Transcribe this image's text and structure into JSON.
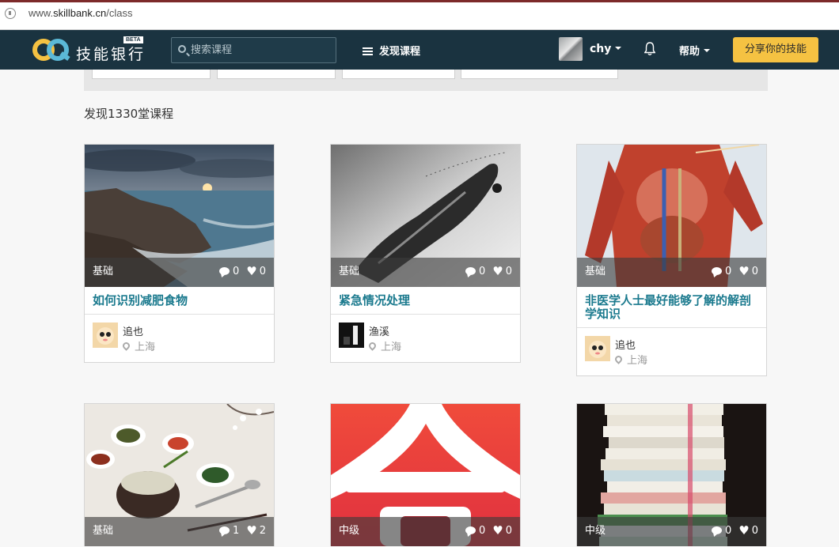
{
  "browser": {
    "url_prefix": "www.",
    "url_host": "skillbank.cn",
    "url_path": "/class"
  },
  "navbar": {
    "logo_text": "技能银行",
    "beta_badge": "BETA",
    "search_placeholder": "搜索课程",
    "discover_label": "发现课程",
    "username": "chy",
    "help_label": "帮助",
    "share_button": "分享你的技能",
    "accent_color": "#f5c242",
    "bar_color": "#1a3340"
  },
  "count_text": "发现1330堂课程",
  "cards": [
    {
      "level": "基础",
      "comments": "0",
      "likes": "0",
      "title": "如何识别减肥食物",
      "author": "追也",
      "location": "上海"
    },
    {
      "level": "基础",
      "comments": "0",
      "likes": "0",
      "title": "紧急情况处理",
      "author": "渔溪",
      "location": "上海"
    },
    {
      "level": "基础",
      "comments": "0",
      "likes": "0",
      "title": "非医学人士最好能够了解的解剖学知识",
      "author": "追也",
      "location": "上海"
    },
    {
      "level": "基础",
      "comments": "1",
      "likes": "2"
    },
    {
      "level": "中级",
      "comments": "0",
      "likes": "0"
    },
    {
      "level": "中级",
      "comments": "0",
      "likes": "0"
    }
  ],
  "title_color": "#1b7a8e"
}
